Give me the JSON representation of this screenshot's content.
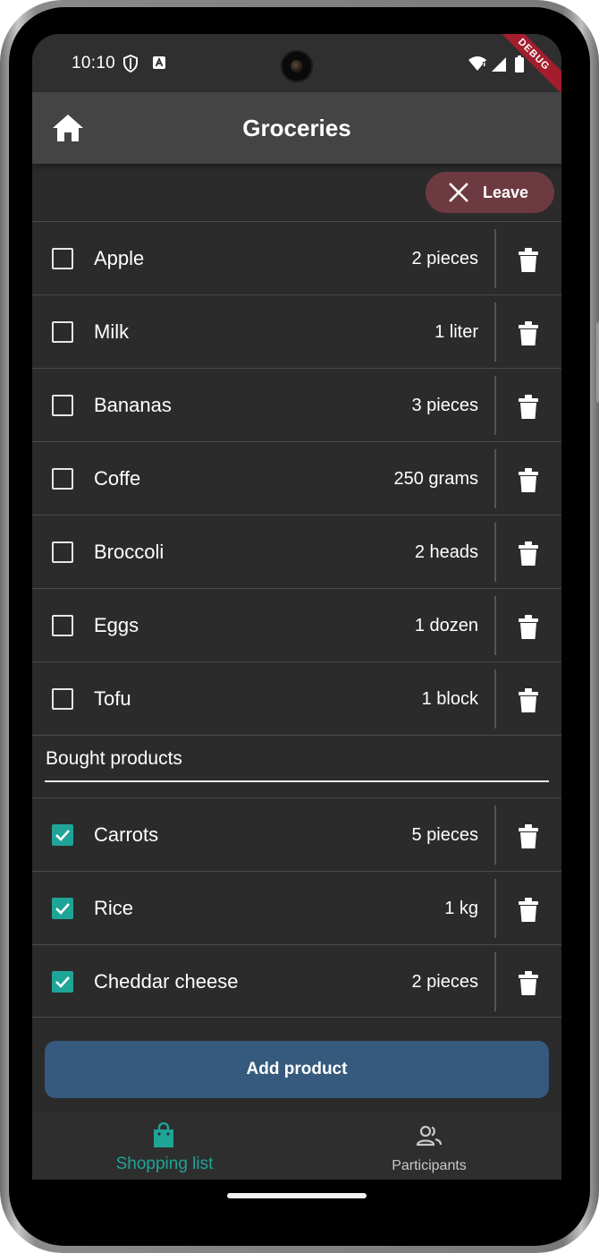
{
  "status_bar": {
    "time": "10:10",
    "debug_label": "DEBUG"
  },
  "app_bar": {
    "title": "Groceries",
    "home_icon": "home-icon"
  },
  "leave_button": {
    "label": "Leave",
    "icon": "close-icon",
    "color": "#6e3a42"
  },
  "shopping_items": [
    {
      "name": "Apple",
      "quantity": "2 pieces",
      "checked": false
    },
    {
      "name": "Milk",
      "quantity": "1 liter",
      "checked": false
    },
    {
      "name": "Bananas",
      "quantity": "3 pieces",
      "checked": false
    },
    {
      "name": "Coffe",
      "quantity": "250 grams",
      "checked": false
    },
    {
      "name": "Broccoli",
      "quantity": "2 heads",
      "checked": false
    },
    {
      "name": "Eggs",
      "quantity": "1 dozen",
      "checked": false
    },
    {
      "name": "Tofu",
      "quantity": "1 block",
      "checked": false
    }
  ],
  "bought_section": {
    "title": "Bought products",
    "items": [
      {
        "name": "Carrots",
        "quantity": "5 pieces",
        "checked": true
      },
      {
        "name": "Rice",
        "quantity": "1 kg",
        "checked": true
      },
      {
        "name": "Cheddar cheese",
        "quantity": "2 pieces",
        "checked": true
      }
    ]
  },
  "add_button": {
    "label": "Add product",
    "color": "#355a7d"
  },
  "bottom_nav": {
    "items": [
      {
        "label": "Shopping list",
        "icon": "shopping-bag-icon",
        "active": true
      },
      {
        "label": "Participants",
        "icon": "people-icon",
        "active": false
      }
    ]
  },
  "colors": {
    "accent": "#1fa498",
    "background": "#2b2b2b",
    "app_bar": "#444444"
  }
}
